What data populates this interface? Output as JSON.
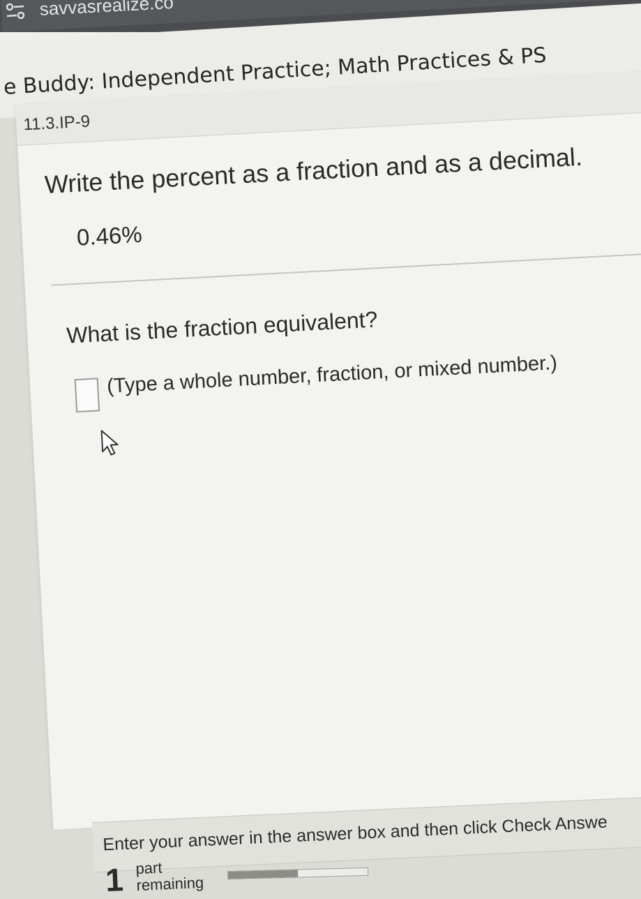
{
  "browser": {
    "url": "savvasrealize.co",
    "site_icon": "site-settings-icon"
  },
  "page": {
    "title": "e Buddy: Independent Practice; Math Practices & PS"
  },
  "question": {
    "id": "11.3.IP-9",
    "instruction": "Write the percent as a fraction and as a decimal.",
    "given_value": "0.46%",
    "prompt": "What is the fraction equivalent?",
    "answer_value": "",
    "answer_hint": "(Type a whole number, fraction, or mixed number.)"
  },
  "footer": {
    "instruction": "Enter your answer in the answer box and then click Check Answe",
    "parts_count": "1",
    "parts_label_line1": "part",
    "parts_label_line2": "remaining",
    "progress_fraction": 0.5
  },
  "colors": {
    "address_bar": "#55575b",
    "page_background": "#f3f3f0"
  }
}
